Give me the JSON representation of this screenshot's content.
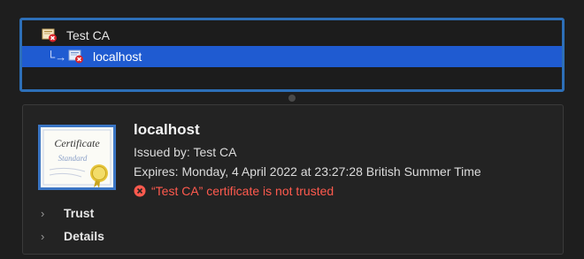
{
  "chain": {
    "root": {
      "label": "Test CA",
      "icon": "certificate-untrusted-icon"
    },
    "child": {
      "label": "localhost",
      "icon": "certificate-untrusted-icon",
      "selected": true
    }
  },
  "certificate": {
    "name": "localhost",
    "issued_by": "Issued by: Test CA",
    "expires": "Expires: Monday, 4 April 2022 at 23:27:28 British Summer Time",
    "warning": "“Test CA” certificate is not trusted",
    "large_icon_text_1": "Certificate",
    "large_icon_text_2": "Standard"
  },
  "sections": {
    "trust": "Trust",
    "details": "Details"
  },
  "colors": {
    "selection": "#1f5bd1",
    "focus_ring": "#2d6fb8",
    "warning": "#ff5a4e"
  }
}
